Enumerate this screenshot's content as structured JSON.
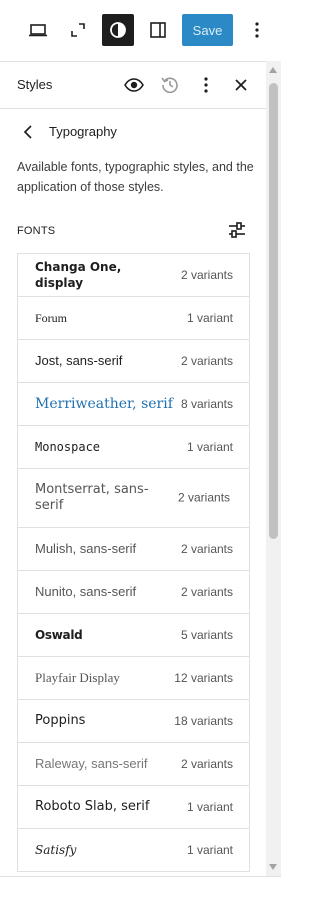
{
  "toolbar": {
    "save_label": "Save"
  },
  "panel": {
    "title": "Styles"
  },
  "typography": {
    "title": "Typography",
    "description": "Available fonts, typographic styles, and the application of those styles.",
    "fonts_label": "FONTS"
  },
  "fonts": [
    {
      "name": "Changa One, display",
      "count": "2 variants"
    },
    {
      "name": "Forum",
      "count": "1 variant"
    },
    {
      "name": "Jost, sans-serif",
      "count": "2 variants"
    },
    {
      "name": "Merriweather, serif",
      "count": "8 variants"
    },
    {
      "name": "Monospace",
      "count": "1 variant"
    },
    {
      "name": "Montserrat, sans-serif",
      "count": "2 variants"
    },
    {
      "name": "Mulish, sans-serif",
      "count": "2 variants"
    },
    {
      "name": "Nunito, sans-serif",
      "count": "2 variants"
    },
    {
      "name": "Oswald",
      "count": "5 variants"
    },
    {
      "name": "Playfair Display",
      "count": "12 variants"
    },
    {
      "name": "Poppins",
      "count": "18 variants"
    },
    {
      "name": "Raleway, sans-serif",
      "count": "2 variants"
    },
    {
      "name": "Roboto Slab, serif",
      "count": "1 variant"
    },
    {
      "name": "Satisfy",
      "count": "1 variant"
    }
  ],
  "colors": {
    "accent": "#2b8ac6",
    "highlight_font": "#2271b1"
  }
}
